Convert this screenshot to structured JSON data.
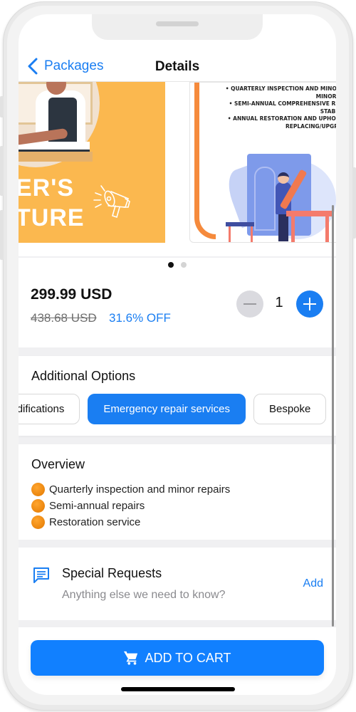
{
  "navbar": {
    "back_label": "Packages",
    "title": "Details"
  },
  "carousel": {
    "slides": [
      {
        "text_line1": "ER'S",
        "text_line2": "TURE"
      },
      {
        "bullets": [
          "• QUARTERLY INSPECTION AND MINOR R",
          "MINOR DA",
          "• SEMI-ANNUAL COMPREHENSIVE REPA",
          "STABILIZ",
          "• ANNUAL RESTORATION AND UPHOLST",
          "REPLACING/UPGRAD"
        ]
      }
    ],
    "active_index": 0,
    "total": 2
  },
  "price": {
    "current": "299.99 USD",
    "original": "438.68 USD",
    "discount": "31.6% OFF",
    "quantity": "1"
  },
  "options": {
    "title": "Additional Options",
    "chips": [
      {
        "label": "Design modifications",
        "selected": false
      },
      {
        "label": "Emergency repair services",
        "selected": true
      },
      {
        "label": "Bespoke",
        "selected": false
      }
    ]
  },
  "overview": {
    "title": "Overview",
    "items": [
      "Quarterly inspection and minor repairs",
      "Semi-annual repairs",
      "Restoration service"
    ]
  },
  "requests": {
    "title": "Special Requests",
    "subtitle": "Anything else we need to know?",
    "action": "Add"
  },
  "cart": {
    "label": "ADD TO CART"
  },
  "colors": {
    "accent": "#1a7ef2",
    "bullet": "#f08c12"
  }
}
